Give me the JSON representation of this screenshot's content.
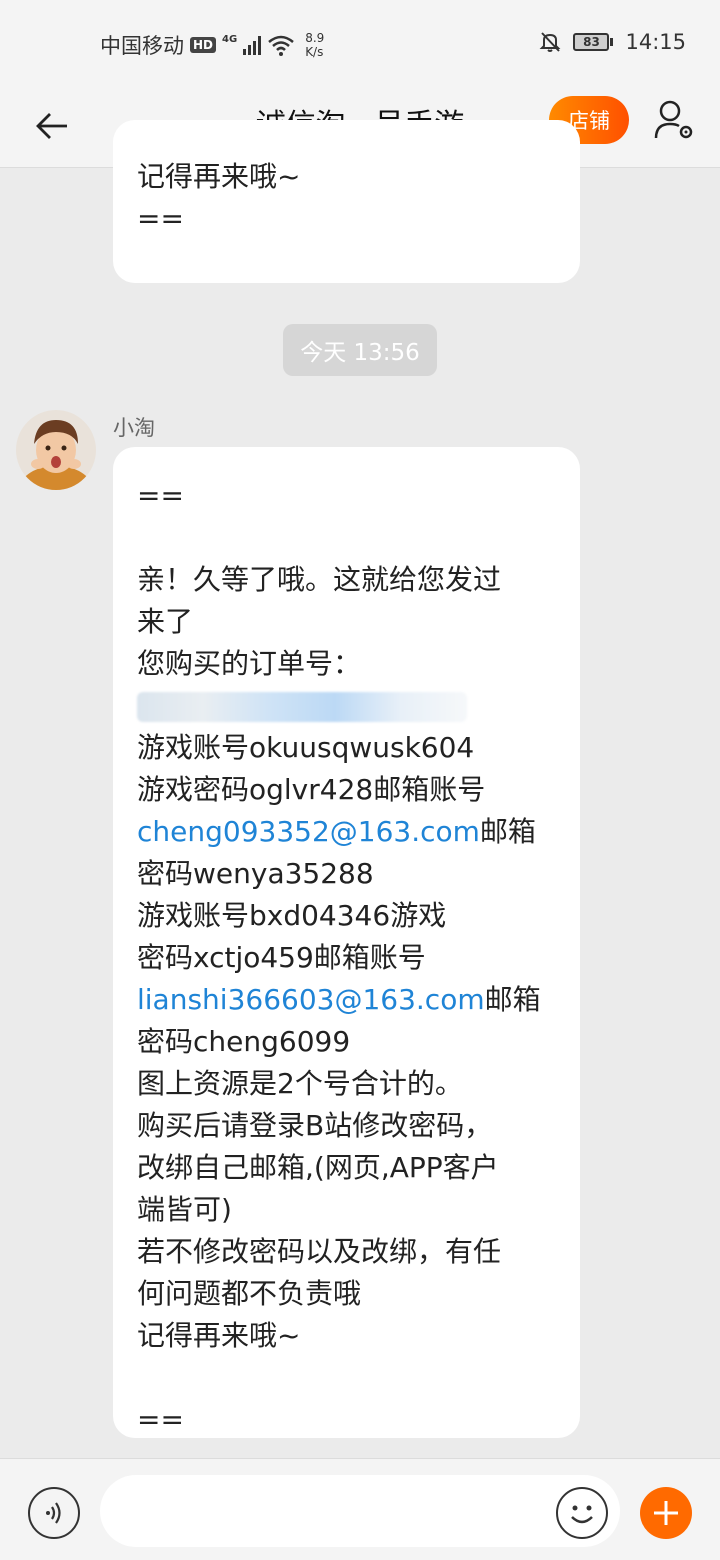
{
  "status_bar": {
    "carrier": "中国移动",
    "hd": "HD",
    "network": "4G",
    "speed_value": "8.9",
    "speed_unit": "K/s",
    "battery": "83",
    "time": "14:15"
  },
  "header": {
    "title": "诚信淘...号手游",
    "shop_label": "店铺"
  },
  "chat": {
    "previous_message": {
      "lines": [
        "记得再来哦~",
        "",
        "=="
      ]
    },
    "time_divider": "今天  13:56",
    "message": {
      "sender": "小淘",
      "lines": [
        "==",
        "",
        "亲！久等了哦。这就给您发过",
        "来了",
        "您购买的订单号：",
        "游戏账号okuusqwusk604",
        "游戏密码oglvr428邮箱账号",
        "cheng093352@163.com",
        "邮箱",
        "密码wenya35288",
        "游戏账号bxd04346游戏",
        "密码xctjo459邮箱账号",
        "lianshi366603@163.com",
        "邮箱",
        "密码cheng6099",
        "图上资源是2个号合计的。",
        "购买后请登录B站修改密码，",
        "改绑自己邮箱,(网页,APP客户",
        "端皆可)",
        "若不修改密码以及改绑，有任",
        "何问题都不负责哦",
        "记得再来哦~",
        "",
        "=="
      ]
    }
  },
  "colors": {
    "accent": "#ff6a00",
    "link": "#1f84d6",
    "background": "#ebebeb"
  },
  "icons": {
    "back": "arrow-left-icon",
    "profile": "user-settings-icon",
    "voice": "voice-icon",
    "emoji": "smile-icon",
    "add": "plus-icon",
    "mute": "bell-off-icon",
    "wifi": "wifi-icon"
  }
}
